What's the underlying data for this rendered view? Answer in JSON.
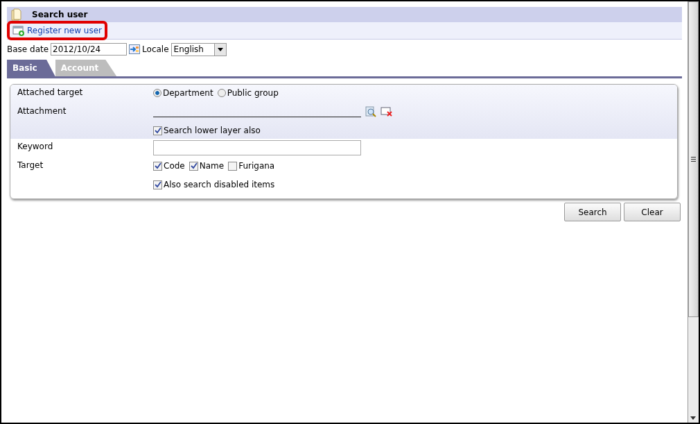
{
  "header": {
    "title": "Search user"
  },
  "actions": [
    {
      "label": "Register new user",
      "highlighted": true
    }
  ],
  "filters": {
    "base_date_label": "Base date",
    "base_date": "2012/10/24",
    "locale_label": "Locale",
    "locale": "English"
  },
  "tabs": [
    {
      "label": "Basic",
      "selected": true
    },
    {
      "label": "Account",
      "selected": false
    }
  ],
  "form": {
    "attached_target": {
      "label": "Attached target",
      "options": [
        {
          "label": "Department",
          "selected": true
        },
        {
          "label": "Public group",
          "selected": false
        }
      ]
    },
    "attachment": {
      "label": "Attachment",
      "value_checkbox": {
        "label": "Search lower layer also",
        "checked": true
      }
    },
    "keyword": {
      "label": "Keyword"
    },
    "target": {
      "label": "Target",
      "options": [
        {
          "label": "Code",
          "checked": true
        },
        {
          "label": "Name",
          "checked": true
        },
        {
          "label": "Furigana",
          "checked": false
        }
      ],
      "extra": {
        "label": "Also search disabled items",
        "checked": true
      }
    }
  },
  "buttons": [
    "Search",
    "Clear"
  ]
}
